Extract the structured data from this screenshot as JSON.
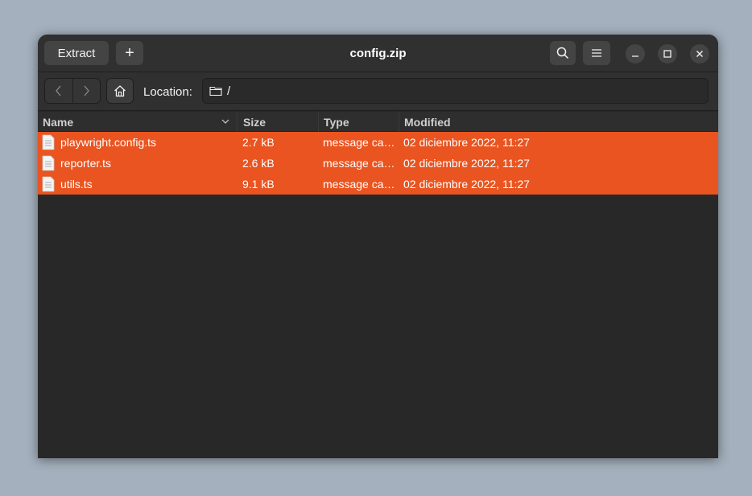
{
  "window": {
    "title": "config.zip"
  },
  "headerbar": {
    "extract_label": "Extract",
    "add_label": "+",
    "search_icon": "search-icon",
    "menu_icon": "hamburger-menu-icon"
  },
  "location": {
    "label": "Location:",
    "path": "/"
  },
  "columns": {
    "name": "Name",
    "size": "Size",
    "type": "Type",
    "modified": "Modified"
  },
  "files": [
    {
      "name": "playwright.config.ts",
      "size": "2.7 kB",
      "type": "message ca…",
      "modified": "02 diciembre 2022, 11:27"
    },
    {
      "name": "reporter.ts",
      "size": "2.6 kB",
      "type": "message ca…",
      "modified": "02 diciembre 2022, 11:27"
    },
    {
      "name": "utils.ts",
      "size": "9.1 kB",
      "type": "message ca…",
      "modified": "02 diciembre 2022, 11:27"
    }
  ],
  "colors": {
    "selection": "#e95420",
    "window_bg": "#282828",
    "desktop_bg": "#a4b0bd"
  }
}
